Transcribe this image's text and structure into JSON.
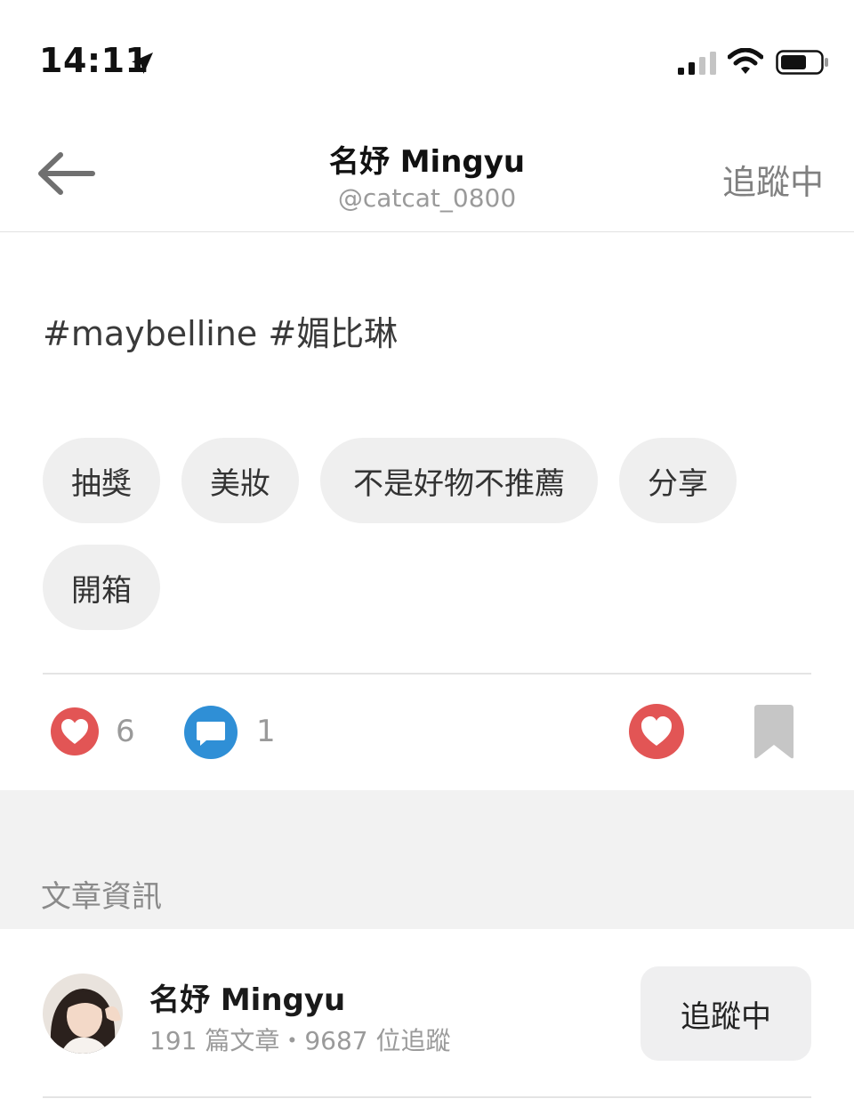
{
  "status_bar": {
    "time": "14:11",
    "icons": [
      "location-arrow-icon",
      "cellular-signal-icon",
      "wifi-icon",
      "battery-icon"
    ]
  },
  "header": {
    "title": "名妤 Mingyu",
    "handle": "@catcat_0800",
    "follow_label": "追蹤中",
    "back_icon": "back-arrow-icon"
  },
  "post": {
    "hashtags": "#maybelline #媚比琳",
    "chips": [
      "抽獎",
      "美妝",
      "不是好物不推薦",
      "分享",
      "開箱"
    ]
  },
  "actions": {
    "like_count": "6",
    "comment_count": "1",
    "colors": {
      "heart": "#e25555",
      "comment": "#2f8fd6",
      "bookmark": "#c6c6c6"
    }
  },
  "info_section": {
    "title": "文章資訊"
  },
  "author": {
    "name": "名妤 Mingyu",
    "stats": "191 篇文章・9687 位追蹤",
    "follow_label": "追蹤中"
  }
}
